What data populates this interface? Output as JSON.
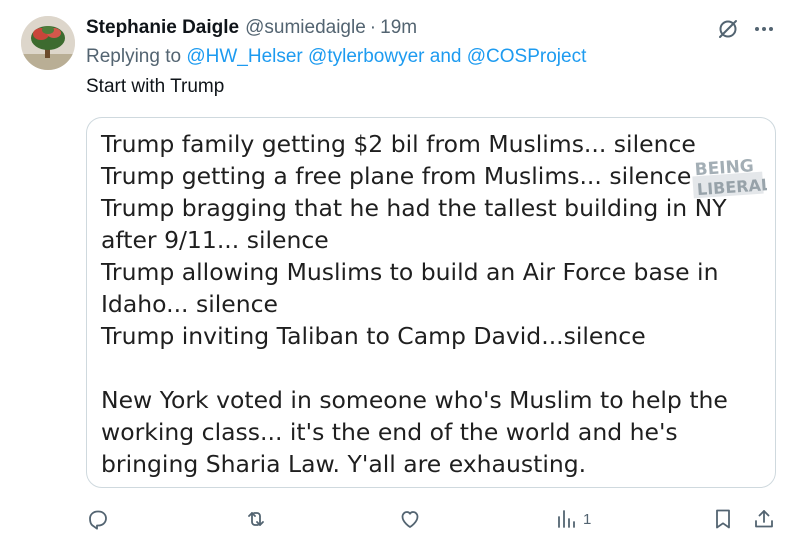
{
  "tweet": {
    "display_name": "Stephanie Daigle",
    "handle": "@sumiedaigle",
    "separator": "·",
    "time": "19m",
    "replying_prefix": "Replying to",
    "reply_mention_1": "@HW_Helser",
    "reply_mention_2": "@tylerbowyer",
    "reply_and": "and",
    "reply_mention_3": "@COSProject",
    "text": "Start with Trump",
    "icons": {
      "avatar": "avatar-tree-photo",
      "grok": "grok-icon",
      "more": "more-dots-icon"
    }
  },
  "media": {
    "lines": [
      "Trump family getting $2 bil from Muslims... silence",
      "Trump getting a free plane from Muslims... silence",
      "Trump bragging that he had the tallest building in NY",
      "after 9/11... silence",
      "Trump allowing Muslims to build an Air Force base in",
      "Idaho... silence",
      "Trump inviting Taliban to Camp David...silence",
      "New York voted in someone who's Muslim to help the",
      "working class... it's the end of the world and he's",
      "bringing Sharia Law. Y'all are exhausting."
    ],
    "watermark_line1": "BEING",
    "watermark_line2": "LIBERAL"
  },
  "actions": {
    "reply_icon": "reply-icon",
    "retweet_icon": "retweet-icon",
    "like_icon": "heart-icon",
    "views_icon": "views-icon",
    "views_count": "1",
    "bookmark_icon": "bookmark-icon",
    "share_icon": "share-icon"
  },
  "colors": {
    "accent": "#1d9bf0",
    "secondary_text": "#536471",
    "border": "#cfd9de"
  }
}
